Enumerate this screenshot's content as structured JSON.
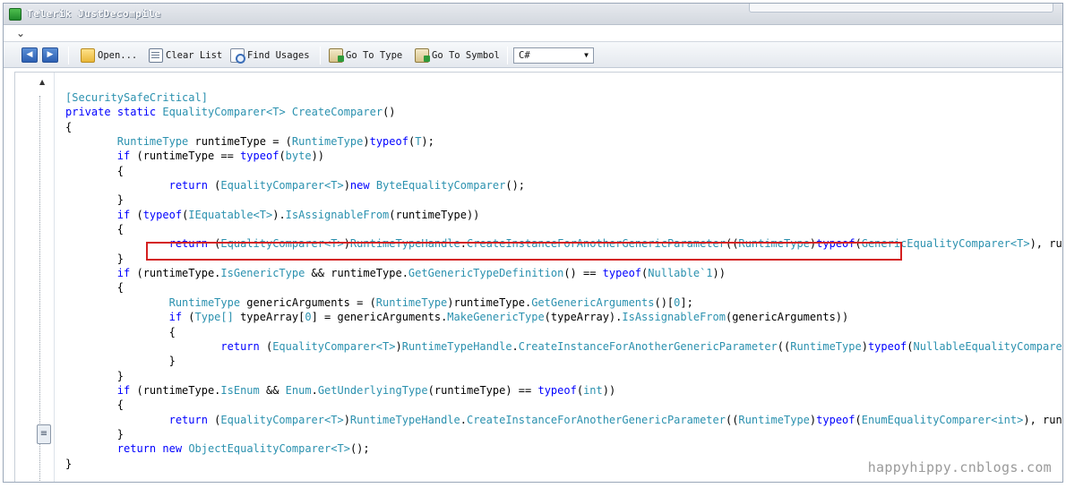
{
  "window": {
    "title": "Telerik JustDecompile"
  },
  "colors": {
    "keyword": "#0000ff",
    "type": "#2b91af",
    "highlight_border": "#d42020"
  },
  "toolbar": {
    "back_icon": "back-arrow-icon",
    "forward_icon": "forward-arrow-icon",
    "open_label": "Open...",
    "clear_list_label": "Clear List",
    "find_usages_label": "Find Usages",
    "go_to_type_label": "Go To Type",
    "go_to_symbol_label": "Go To Symbol",
    "language_selected": "C#"
  },
  "code_lines": [
    [
      [
        "ty",
        "[SecuritySafeCritical]"
      ]
    ],
    [
      [
        "kw",
        "private"
      ],
      [
        "p",
        " "
      ],
      [
        "kw",
        "static"
      ],
      [
        "p",
        " "
      ],
      [
        "ty",
        "EqualityComparer<T>"
      ],
      [
        "p",
        " "
      ],
      [
        "ty",
        "CreateComparer"
      ],
      [
        "p",
        "()"
      ]
    ],
    [
      [
        "p",
        "{"
      ]
    ],
    [
      [
        "p",
        "        "
      ],
      [
        "ty",
        "RuntimeType"
      ],
      [
        "p",
        " runtimeType = ("
      ],
      [
        "ty",
        "RuntimeType"
      ],
      [
        "p",
        ")"
      ],
      [
        "kw",
        "typeof"
      ],
      [
        "p",
        "("
      ],
      [
        "ty",
        "T"
      ],
      [
        "p",
        ");"
      ]
    ],
    [
      [
        "p",
        "        "
      ],
      [
        "kw",
        "if"
      ],
      [
        "p",
        " (runtimeType == "
      ],
      [
        "kw",
        "typeof"
      ],
      [
        "p",
        "("
      ],
      [
        "ty",
        "byte"
      ],
      [
        "p",
        "))"
      ]
    ],
    [
      [
        "p",
        "        {"
      ]
    ],
    [
      [
        "p",
        "                "
      ],
      [
        "kw",
        "return"
      ],
      [
        "p",
        " ("
      ],
      [
        "ty",
        "EqualityComparer<T>"
      ],
      [
        "p",
        ")"
      ],
      [
        "kw",
        "new"
      ],
      [
        "p",
        " "
      ],
      [
        "ty",
        "ByteEqualityComparer"
      ],
      [
        "p",
        "();"
      ]
    ],
    [
      [
        "p",
        "        }"
      ]
    ],
    [
      [
        "p",
        "        "
      ],
      [
        "kw",
        "if"
      ],
      [
        "p",
        " ("
      ],
      [
        "kw",
        "typeof"
      ],
      [
        "p",
        "("
      ],
      [
        "ty",
        "IEquatable<T>"
      ],
      [
        "p",
        ")."
      ],
      [
        "ty",
        "IsAssignableFrom"
      ],
      [
        "p",
        "(runtimeType))"
      ]
    ],
    [
      [
        "p",
        "        {"
      ]
    ],
    [
      [
        "p",
        "                "
      ],
      [
        "kw",
        "return"
      ],
      [
        "p",
        " ("
      ],
      [
        "ty",
        "EqualityComparer<T>"
      ],
      [
        "p",
        ")"
      ],
      [
        "ty",
        "RuntimeTypeHandle"
      ],
      [
        "p",
        "."
      ],
      [
        "ty",
        "CreateInstanceForAnotherGenericParameter"
      ],
      [
        "p",
        "(("
      ],
      [
        "ty",
        "RuntimeType"
      ],
      [
        "p",
        ")"
      ],
      [
        "kw",
        "typeof"
      ],
      [
        "p",
        "("
      ],
      [
        "ty",
        "GenericEqualityComparer<T>"
      ],
      [
        "p",
        "), runtimeType);"
      ]
    ],
    [
      [
        "p",
        "        }"
      ]
    ],
    [
      [
        "p",
        "        "
      ],
      [
        "kw",
        "if"
      ],
      [
        "p",
        " (runtimeType."
      ],
      [
        "ty",
        "IsGenericType"
      ],
      [
        "p",
        " && runtimeType."
      ],
      [
        "ty",
        "GetGenericTypeDefinition"
      ],
      [
        "p",
        "() == "
      ],
      [
        "kw",
        "typeof"
      ],
      [
        "p",
        "("
      ],
      [
        "ty",
        "Nullable`1"
      ],
      [
        "p",
        "))"
      ]
    ],
    [
      [
        "p",
        "        {"
      ]
    ],
    [
      [
        "p",
        "                "
      ],
      [
        "ty",
        "RuntimeType"
      ],
      [
        "p",
        " genericArguments = ("
      ],
      [
        "ty",
        "RuntimeType"
      ],
      [
        "p",
        ")runtimeType."
      ],
      [
        "ty",
        "GetGenericArguments"
      ],
      [
        "p",
        "()["
      ],
      [
        "lit",
        "0"
      ],
      [
        "p",
        "];"
      ]
    ],
    [
      [
        "p",
        "                "
      ],
      [
        "kw",
        "if"
      ],
      [
        "p",
        " ("
      ],
      [
        "ty",
        "Type[]"
      ],
      [
        "p",
        " typeArray["
      ],
      [
        "lit",
        "0"
      ],
      [
        "p",
        "] = genericArguments."
      ],
      [
        "ty",
        "MakeGenericType"
      ],
      [
        "p",
        "(typeArray)."
      ],
      [
        "ty",
        "IsAssignableFrom"
      ],
      [
        "p",
        "(genericArguments))"
      ]
    ],
    [
      [
        "p",
        "                {"
      ]
    ],
    [
      [
        "p",
        "                        "
      ],
      [
        "kw",
        "return"
      ],
      [
        "p",
        " ("
      ],
      [
        "ty",
        "EqualityComparer<T>"
      ],
      [
        "p",
        ")"
      ],
      [
        "ty",
        "RuntimeTypeHandle"
      ],
      [
        "p",
        "."
      ],
      [
        "ty",
        "CreateInstanceForAnotherGenericParameter"
      ],
      [
        "p",
        "(("
      ],
      [
        "ty",
        "RuntimeType"
      ],
      [
        "p",
        ")"
      ],
      [
        "kw",
        "typeof"
      ],
      [
        "p",
        "("
      ],
      [
        "ty",
        "NullableEqualityComparer<int>"
      ],
      [
        "p",
        "), genericArguments);"
      ]
    ],
    [
      [
        "p",
        "                }"
      ]
    ],
    [
      [
        "p",
        "        }"
      ]
    ],
    [
      [
        "p",
        "        "
      ],
      [
        "kw",
        "if"
      ],
      [
        "p",
        " (runtimeType."
      ],
      [
        "ty",
        "IsEnum"
      ],
      [
        "p",
        " && "
      ],
      [
        "ty",
        "Enum"
      ],
      [
        "p",
        "."
      ],
      [
        "ty",
        "GetUnderlyingType"
      ],
      [
        "p",
        "(runtimeType) == "
      ],
      [
        "kw",
        "typeof"
      ],
      [
        "p",
        "("
      ],
      [
        "ty",
        "int"
      ],
      [
        "p",
        "))"
      ]
    ],
    [
      [
        "p",
        "        {"
      ]
    ],
    [
      [
        "p",
        "                "
      ],
      [
        "kw",
        "return"
      ],
      [
        "p",
        " ("
      ],
      [
        "ty",
        "EqualityComparer<T>"
      ],
      [
        "p",
        ")"
      ],
      [
        "ty",
        "RuntimeTypeHandle"
      ],
      [
        "p",
        "."
      ],
      [
        "ty",
        "CreateInstanceForAnotherGenericParameter"
      ],
      [
        "p",
        "(("
      ],
      [
        "ty",
        "RuntimeType"
      ],
      [
        "p",
        ")"
      ],
      [
        "kw",
        "typeof"
      ],
      [
        "p",
        "("
      ],
      [
        "ty",
        "EnumEqualityComparer<int>"
      ],
      [
        "p",
        "), runtimeType);"
      ]
    ],
    [
      [
        "p",
        "        }"
      ]
    ],
    [
      [
        "p",
        "        "
      ],
      [
        "kw",
        "return"
      ],
      [
        "p",
        " "
      ],
      [
        "kw",
        "new"
      ],
      [
        "p",
        " "
      ],
      [
        "ty",
        "ObjectEqualityComparer<T>"
      ],
      [
        "p",
        "();"
      ]
    ],
    [
      [
        "p",
        "}"
      ]
    ]
  ],
  "watermark": "happyhippy.cnblogs.com"
}
